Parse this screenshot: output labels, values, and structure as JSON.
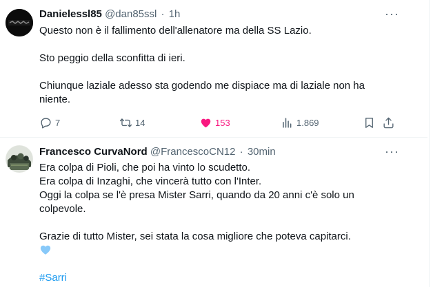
{
  "tweets": [
    {
      "author": "Danielessl85",
      "handle": "@dan85ssl",
      "separator": "·",
      "time": "1h",
      "lines": [
        "Questo non è il fallimento dell'allenatore ma della SS Lazio.",
        "",
        "Sto peggio della sconfitta di ieri.",
        "",
        "Chiunque laziale adesso sta godendo me dispiace ma di laziale non ha",
        "niente."
      ],
      "stats": {
        "replies": "7",
        "retweets": "14",
        "likes": "153",
        "views": "1.869"
      },
      "liked": true
    },
    {
      "author": "Francesco CurvaNord",
      "handle": "@FrancescoCN12",
      "separator": "·",
      "time": "30min",
      "lines": [
        "Era colpa di Pioli, che poi ha vinto lo scudetto.",
        "Era colpa di Inzaghi, che vincerà tutto con l'Inter.",
        "Oggi la colpa se l'è presa Mister Sarri, quando da 20 anni c'è solo un",
        "colpevole.",
        "",
        "Grazie di tutto Mister, sei stata la cosa migliore che poteva capitarci."
      ],
      "emoji": "light-blue-heart",
      "hashtag": "#Sarri"
    }
  ],
  "colors": {
    "text": "#0f1419",
    "secondary": "#536471",
    "link": "#1d9bf0",
    "like": "#f91880",
    "emoji_heart": "#88c9f9"
  }
}
